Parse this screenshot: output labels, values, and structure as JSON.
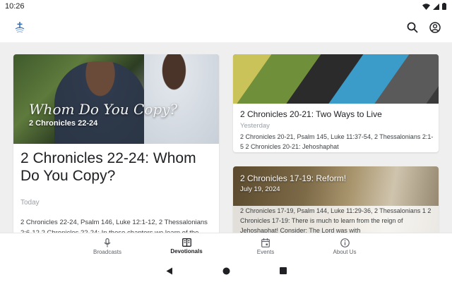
{
  "status_bar": {
    "time": "10:26",
    "icons": [
      "wifi-icon",
      "signal-icon",
      "battery-icon"
    ]
  },
  "app_bar": {
    "logo": "church-logo",
    "actions": [
      "search-icon",
      "account-icon"
    ]
  },
  "cards": [
    {
      "image_title": "Whom Do You Copy?",
      "image_subtitle": "2 Chronicles 22-24",
      "title": "2 Chronicles 22-24: Whom Do You Copy?",
      "date": "Today",
      "desc": "2 Chronicles 22-24, Psalm 146, Luke 12:1-12, 2 Thessalonians 2:6-12 2 Chronicles 22-24: In these chapters we learn of the importance of influence—mentors, forebears,"
    },
    {
      "title": "2 Chronicles 20-21: Two Ways to Live",
      "date": "Yesterday",
      "desc": "2 Chronicles 20-21, Psalm 145, Luke 11:37-54, 2 Thessalonians 2:1-5 2 Chronicles 20-21: Jehoshaphat"
    },
    {
      "title": "2 Chronicles 17-19: Reform!",
      "date": "July 19, 2024",
      "desc": "2 Chronicles 17-19, Psalm 144, Luke 11:29-36, 2 Thessalonians 1 2 Chronicles 17-19: There is much to learn from the reign of Jehoshaphat! Consider: The Lord was with"
    }
  ],
  "bottom_nav": [
    {
      "label": "Broadcasts",
      "icon": "microphone-icon",
      "active": false
    },
    {
      "label": "Devotionals",
      "icon": "book-icon",
      "active": true
    },
    {
      "label": "Events",
      "icon": "calendar-icon",
      "active": false
    },
    {
      "label": "About Us",
      "icon": "info-icon",
      "active": false
    }
  ],
  "colors": {
    "accent": "#202124",
    "background": "#efefef",
    "muted": "#9aa0a6"
  }
}
